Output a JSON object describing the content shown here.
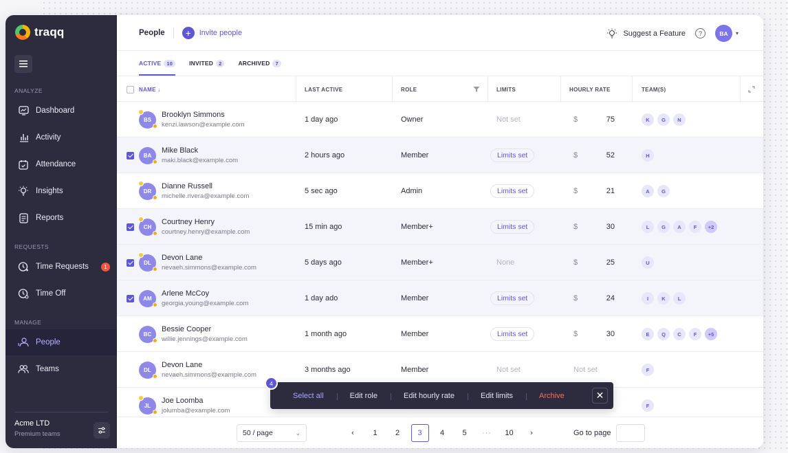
{
  "brand": {
    "name": "traqq"
  },
  "sidebar": {
    "sections": [
      {
        "label": "ANALYZE"
      },
      {
        "label": "REQUESTS"
      },
      {
        "label": "MANAGE"
      }
    ],
    "items": [
      {
        "label": "Dashboard",
        "icon": "dashboard-icon"
      },
      {
        "label": "Activity",
        "icon": "activity-icon"
      },
      {
        "label": "Attendance",
        "icon": "attendance-icon"
      },
      {
        "label": "Insights",
        "icon": "insights-icon"
      },
      {
        "label": "Reports",
        "icon": "reports-icon"
      },
      {
        "label": "Time Requests",
        "icon": "time-requests-icon",
        "badge": "1"
      },
      {
        "label": "Time Off",
        "icon": "time-off-icon"
      },
      {
        "label": "People",
        "icon": "people-icon",
        "active": true
      },
      {
        "label": "Teams",
        "icon": "teams-icon"
      }
    ],
    "company": {
      "name": "Acme LTD",
      "plan": "Premium teams"
    }
  },
  "header": {
    "title": "People",
    "invite_label": "Invite people",
    "suggest_label": "Suggest a Feature",
    "help_glyph": "?",
    "user_initials": "BA"
  },
  "tabs": [
    {
      "label": "ACTIVE",
      "count": "10",
      "active": true
    },
    {
      "label": "INVITED",
      "count": "2"
    },
    {
      "label": "ARCHIVED",
      "count": "7"
    }
  ],
  "table": {
    "columns": {
      "name": "NAME ↓",
      "last_active": "LAST ACTIVE",
      "role": "ROLE",
      "limits": "LIMITS",
      "hourly_rate": "HOURLY RATE",
      "teams": "TEAM(S)"
    },
    "rows": [
      {
        "initials": "BS",
        "name": "Brooklyn Simmons",
        "email": "kenzi.lawson@example.com",
        "last_active": "1 day ago",
        "role": "Owner",
        "limits": "Not set",
        "limits_style": "muted",
        "currency": "$",
        "rate": "75",
        "teams": [
          "K",
          "G",
          "N"
        ],
        "selected": false
      },
      {
        "initials": "BA",
        "name": "Mike Black",
        "email": "maki.black@example.com",
        "last_active": "2 hours ago",
        "role": "Member",
        "limits": "Limits set",
        "limits_style": "pill",
        "currency": "$",
        "rate": "52",
        "teams": [
          "H"
        ],
        "selected": true
      },
      {
        "initials": "DR",
        "name": "Dianne Russell",
        "email": "michelle.rivera@example.com",
        "last_active": "5 sec ago",
        "role": "Admin",
        "limits": "Limits set",
        "limits_style": "pill",
        "currency": "$",
        "rate": "21",
        "teams": [
          "A",
          "G"
        ],
        "selected": false
      },
      {
        "initials": "CH",
        "name": "Courtney Henry",
        "email": "courtney.henry@example.com",
        "last_active": "15 min ago",
        "role": "Member+",
        "limits": "Limits set",
        "limits_style": "pill",
        "currency": "$",
        "rate": "30",
        "teams": [
          "L",
          "G",
          "A",
          "F",
          "+2"
        ],
        "selected": true
      },
      {
        "initials": "DL",
        "name": "Devon Lane",
        "email": "nevaeh.simmons@example.com",
        "last_active": "5 days ago",
        "role": "Member+",
        "limits": "None",
        "limits_style": "muted",
        "currency": "$",
        "rate": "25",
        "teams": [
          "U"
        ],
        "selected": true
      },
      {
        "initials": "AM",
        "name": "Arlene McCoy",
        "email": "georgia.young@example.com",
        "last_active": "1 day ado",
        "role": "Member",
        "limits": "Limits set",
        "limits_style": "pill",
        "currency": "$",
        "rate": "24",
        "teams": [
          "I",
          "K",
          "L"
        ],
        "selected": true
      },
      {
        "initials": "BC",
        "name": "Bessie Cooper",
        "email": "willie.jennings@example.com",
        "last_active": "1 month ago",
        "role": "Member",
        "limits": "Limits set",
        "limits_style": "pill",
        "currency": "$",
        "rate": "30",
        "teams": [
          "E",
          "Q",
          "C",
          "F",
          "+5"
        ],
        "selected": false
      },
      {
        "initials": "DL",
        "name": "Devon Lane",
        "email": "nevaeh.simmons@example.com",
        "last_active": "3 months ago",
        "role": "Member",
        "limits": "Not set",
        "limits_style": "muted",
        "currency": "",
        "rate": "",
        "rate_text": "Not set",
        "teams": [
          "F"
        ],
        "selected": false
      },
      {
        "initials": "JL",
        "name": "Joe Loomba",
        "email": "jolumba@example.com",
        "last_active": "",
        "role": "",
        "limits": "",
        "limits_style": "muted",
        "currency": "",
        "rate": "",
        "teams": [
          "F"
        ],
        "selected": false
      }
    ]
  },
  "bulk_actions": {
    "count": "4",
    "actions": [
      "Select all",
      "Edit role",
      "Edit hourly rate",
      "Edit limits",
      "Archive"
    ],
    "close_glyph": "✕"
  },
  "pagination": {
    "per_page": "50 / page",
    "prev_glyph": "‹",
    "next_glyph": "›",
    "pages": [
      "1",
      "2",
      "3",
      "4",
      "5",
      "···",
      "10"
    ],
    "current": "3",
    "goto_label": "Go to page"
  },
  "colors": {
    "accent": "#5e56d6",
    "sidebar": "#2d2c3f",
    "danger": "#ff6a58"
  }
}
